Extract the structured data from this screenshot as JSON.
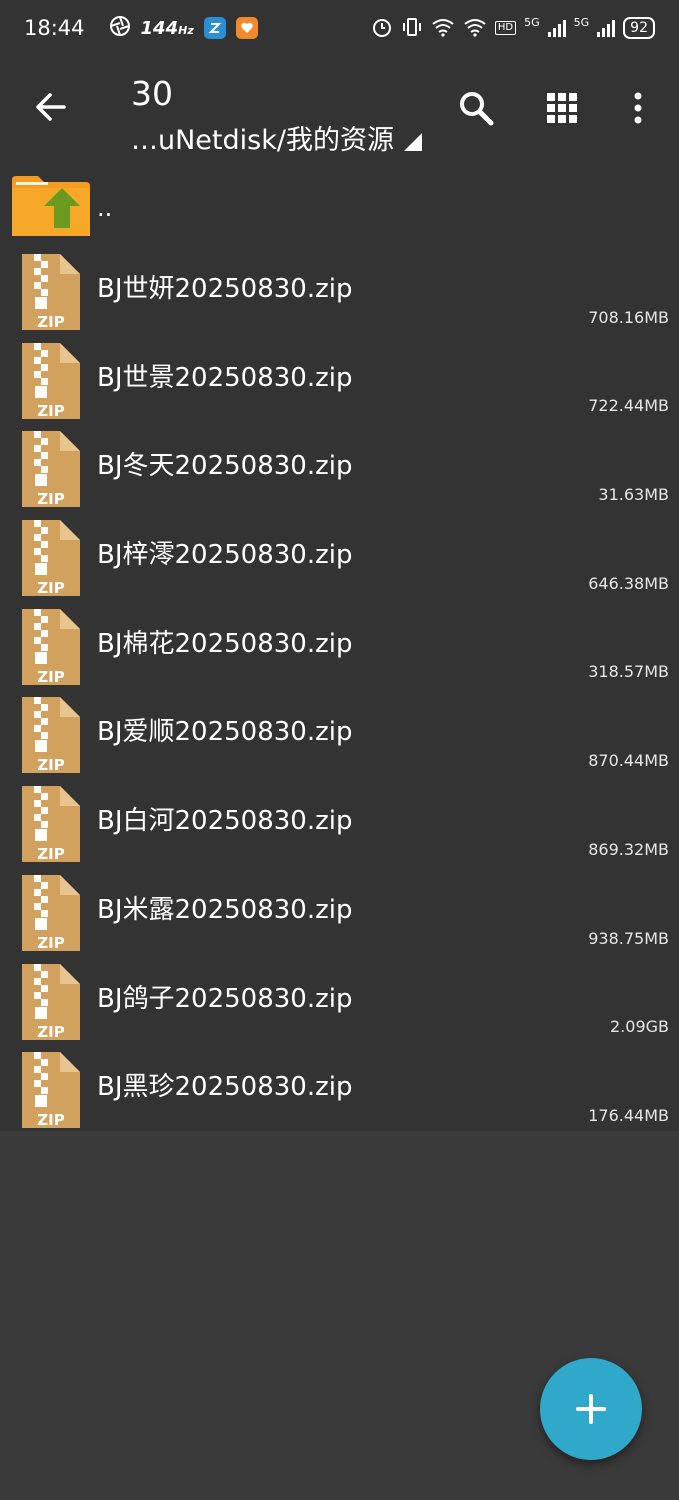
{
  "status_bar": {
    "time": "18:44",
    "refresh_rate": "144",
    "refresh_unit": "Hz",
    "network_1": "5G",
    "network_2": "5G",
    "hd_label": "HD",
    "battery": "92"
  },
  "app_bar": {
    "title": "30",
    "path": "…uNetdisk/我的资源"
  },
  "parent_dir": {
    "label": ".."
  },
  "files": [
    {
      "name": "BJ世妍20250830.zip",
      "size": "708.16MB"
    },
    {
      "name": "BJ世景20250830.zip",
      "size": "722.44MB"
    },
    {
      "name": "BJ冬天20250830.zip",
      "size": "31.63MB"
    },
    {
      "name": "BJ梓澪20250830.zip",
      "size": "646.38MB"
    },
    {
      "name": "BJ棉花20250830.zip",
      "size": "318.57MB"
    },
    {
      "name": "BJ爱顺20250830.zip",
      "size": "870.44MB"
    },
    {
      "name": "BJ白河20250830.zip",
      "size": "869.32MB"
    },
    {
      "name": "BJ米露20250830.zip",
      "size": "938.75MB"
    },
    {
      "name": "BJ鸽子20250830.zip",
      "size": "2.09GB"
    },
    {
      "name": "BJ黑珍20250830.zip",
      "size": "176.44MB"
    }
  ],
  "icons": {
    "file_type_label": "ZIP",
    "back": "back-arrow-icon",
    "search": "search-icon",
    "grid": "grid-view-icon",
    "more": "more-vert-icon",
    "fab": "plus-icon"
  },
  "colors": {
    "background": "#3a3a3a",
    "bar": "#333333",
    "fab": "#2fa8c9",
    "zip": "#d3a15e",
    "folder": "#f39c1f",
    "folder_arrow": "#6a9a1f"
  }
}
